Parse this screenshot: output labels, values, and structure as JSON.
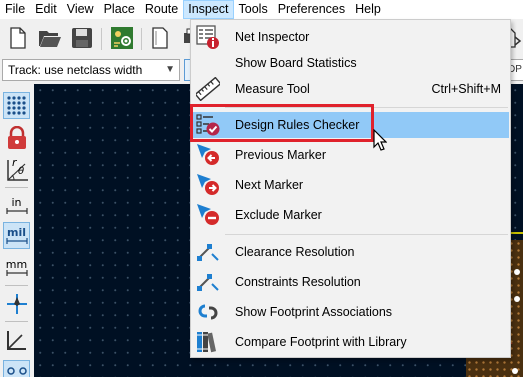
{
  "menubar": {
    "items": [
      "File",
      "Edit",
      "View",
      "Place",
      "Route",
      "Inspect",
      "Tools",
      "Preferences",
      "Help"
    ],
    "active": "Inspect"
  },
  "toolbar2": {
    "track_combo": "Track: use netclass width",
    "partial_right": "DP"
  },
  "lefttb": {
    "polar_label": "r",
    "polar_sub": "θ",
    "units_in": "in",
    "units_mil": "mil",
    "units_mm": "mm"
  },
  "dropdown": {
    "net_inspector": "Net Inspector",
    "board_statistics": "Show Board Statistics",
    "measure_tool": "Measure Tool",
    "measure_shortcut": "Ctrl+Shift+M",
    "drc": "Design Rules Checker",
    "previous_marker": "Previous Marker",
    "next_marker": "Next Marker",
    "exclude_marker": "Exclude Marker",
    "clearance_resolution": "Clearance Resolution",
    "constraints_resolution": "Constraints Resolution",
    "footprint_associations": "Show Footprint Associations",
    "compare_footprint": "Compare Footprint with Library"
  },
  "colors": {
    "highlight": "#91c9f7",
    "callout_frame": "#e0222c",
    "canvas_bg": "#001023",
    "marker_red": "#d42a2a",
    "marker_blue": "#1e7fd0"
  }
}
